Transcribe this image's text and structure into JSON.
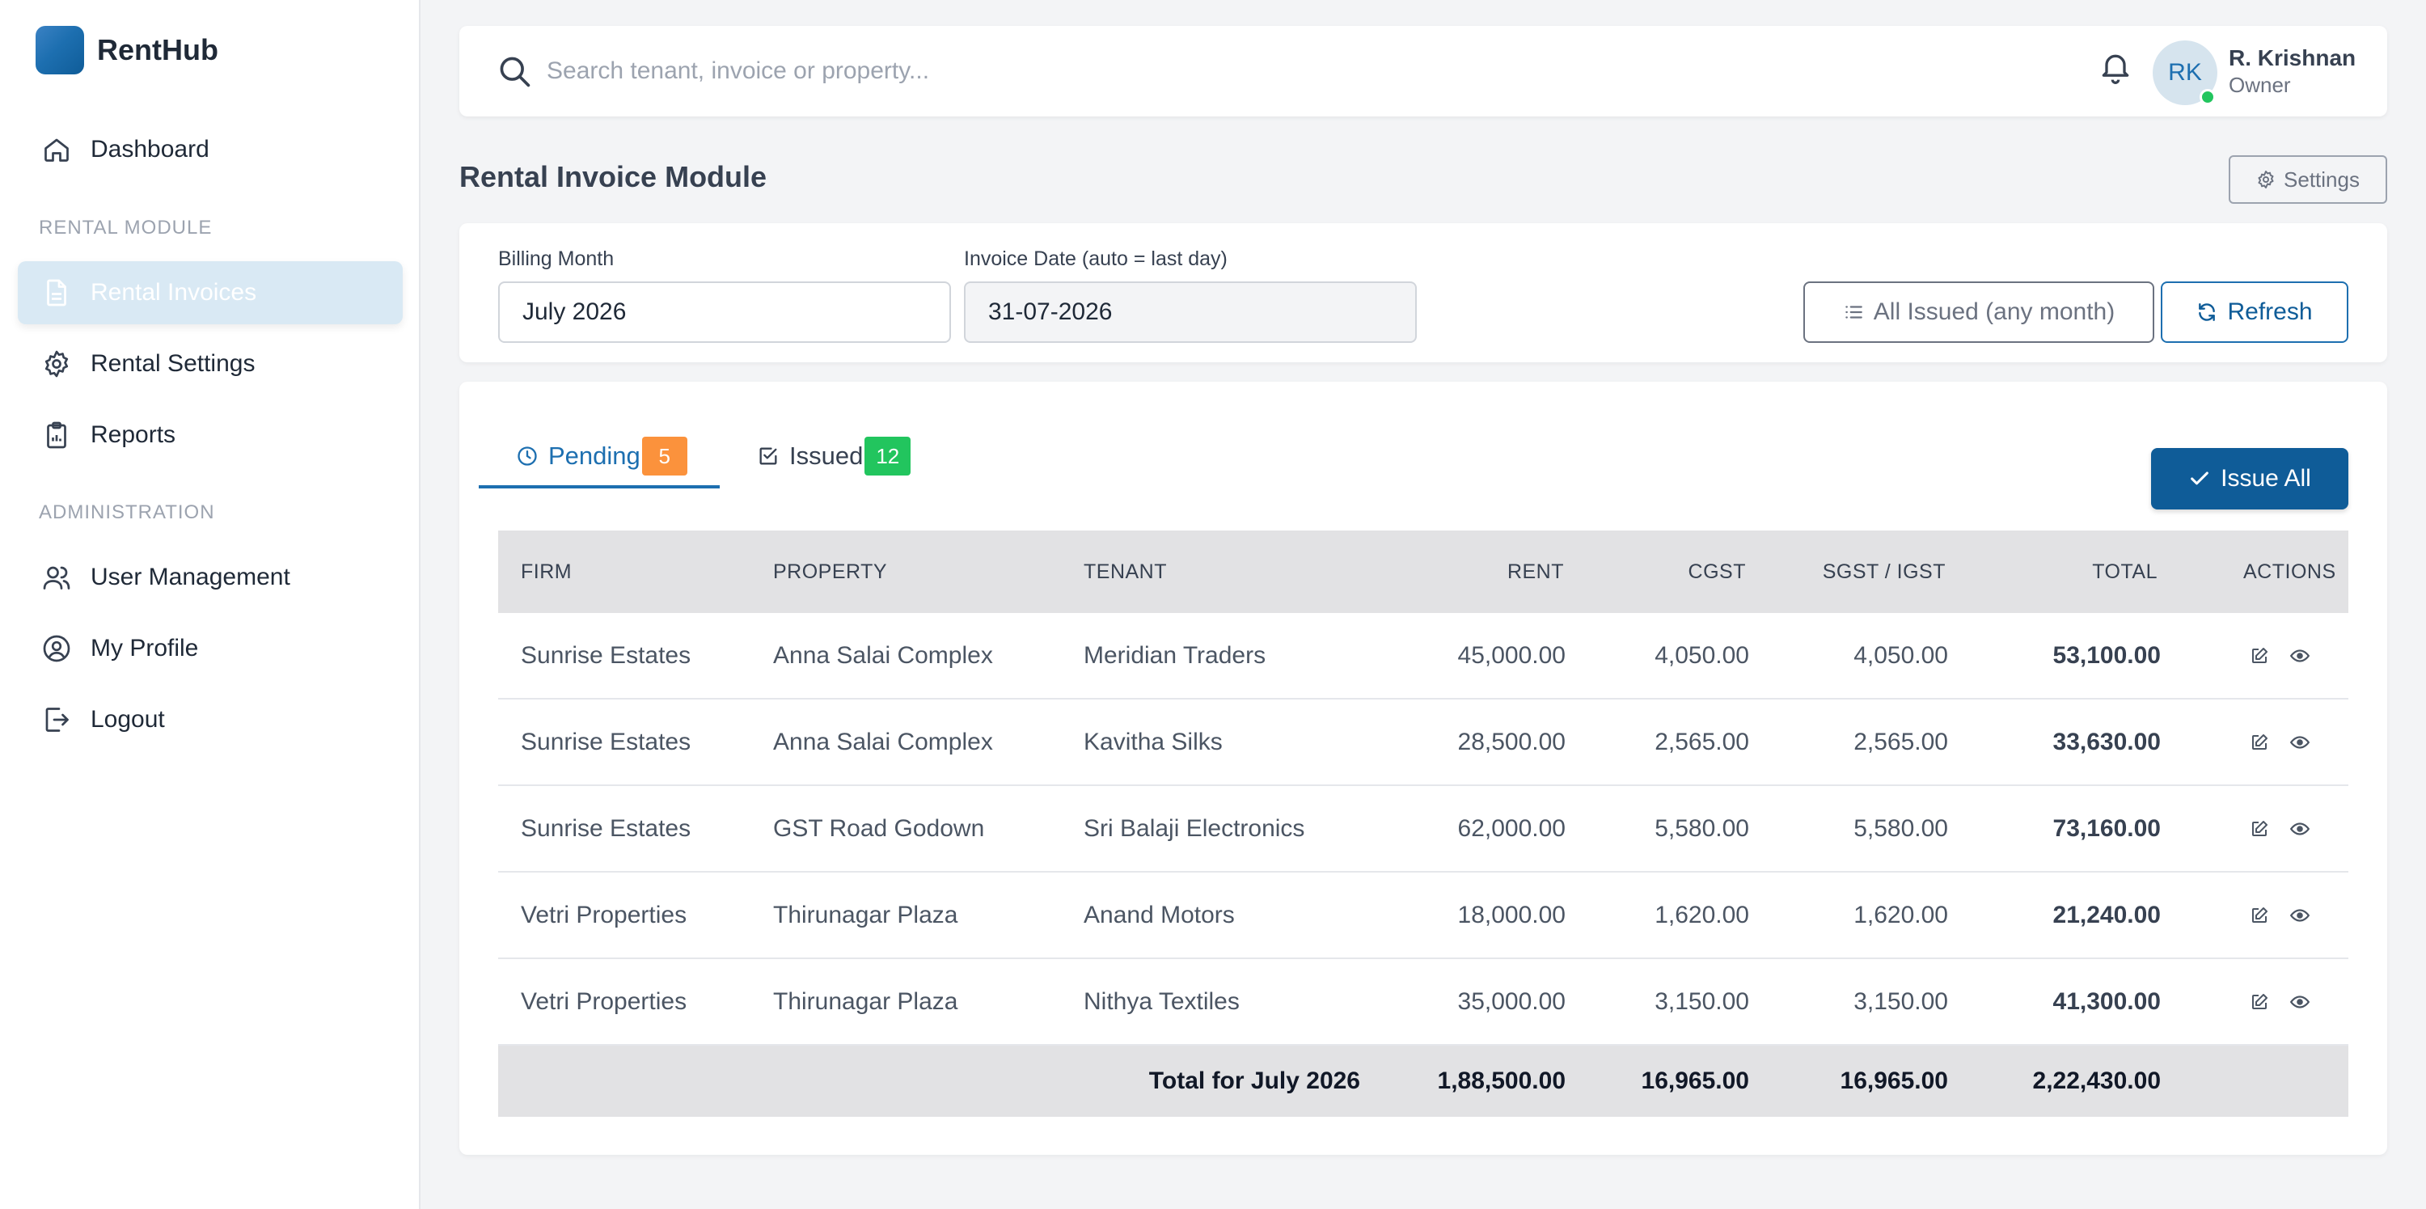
{
  "app": {
    "name": "RentHub"
  },
  "sidebar": {
    "items": [
      {
        "label": "Dashboard",
        "icon": "home-icon"
      },
      {
        "label": "Rental Invoices",
        "icon": "document-icon",
        "active": true
      },
      {
        "label": "Rental Settings",
        "icon": "gear-icon"
      },
      {
        "label": "Reports",
        "icon": "clipboard-icon"
      },
      {
        "label": "User Management",
        "icon": "users-icon"
      },
      {
        "label": "My Profile",
        "icon": "user-circle-icon"
      },
      {
        "label": "Logout",
        "icon": "logout-icon"
      }
    ],
    "sections": [
      "RENTAL MODULE",
      "ADMINISTRATION"
    ]
  },
  "search": {
    "placeholder": "Search tenant, invoice or property..."
  },
  "user": {
    "initials": "RK",
    "name": "R. Krishnan",
    "role": "Owner"
  },
  "page": {
    "title": "Rental Invoice Module",
    "settings_label": "Settings"
  },
  "filters": {
    "billing_month_label": "Billing Month",
    "billing_month_value": "July 2026",
    "invoice_date_label": "Invoice Date (auto = last day)",
    "invoice_date_value": "31-07-2026",
    "all_issued_label": "All Issued (any month)",
    "refresh_label": "Refresh"
  },
  "tabs": [
    {
      "label": "Pending",
      "count": "5"
    },
    {
      "label": "Issued",
      "count": "12"
    }
  ],
  "issue_all_label": "Issue All",
  "table": {
    "headers": [
      "FIRM",
      "PROPERTY",
      "TENANT",
      "RENT",
      "CGST",
      "SGST / IGST",
      "TOTAL",
      "ACTIONS"
    ],
    "rows": [
      [
        "Sunrise Estates",
        "Anna Salai Complex",
        "Meridian Traders",
        "45,000.00",
        "4,050.00",
        "4,050.00",
        "53,100.00"
      ],
      [
        "Sunrise Estates",
        "Anna Salai Complex",
        "Kavitha Silks",
        "28,500.00",
        "2,565.00",
        "2,565.00",
        "33,630.00"
      ],
      [
        "Sunrise Estates",
        "GST Road Godown",
        "Sri Balaji Electronics",
        "62,000.00",
        "5,580.00",
        "5,580.00",
        "73,160.00"
      ],
      [
        "Vetri Properties",
        "Thirunagar Plaza",
        "Anand Motors",
        "18,000.00",
        "1,620.00",
        "1,620.00",
        "21,240.00"
      ],
      [
        "Vetri Properties",
        "Thirunagar Plaza",
        "Nithya Textiles",
        "35,000.00",
        "3,150.00",
        "3,150.00",
        "41,300.00"
      ]
    ],
    "footer": {
      "label": "Total for July 2026",
      "rent": "1,88,500.00",
      "cgst": "16,965.00",
      "sgst": "16,965.00",
      "total": "2,22,430.00"
    }
  },
  "colors": {
    "accent": "#1d6fb0",
    "brand_dark": "#0f5c98",
    "pending_badge": "#fb923c",
    "issued_badge": "#22c55e",
    "online": "#22c55e"
  }
}
